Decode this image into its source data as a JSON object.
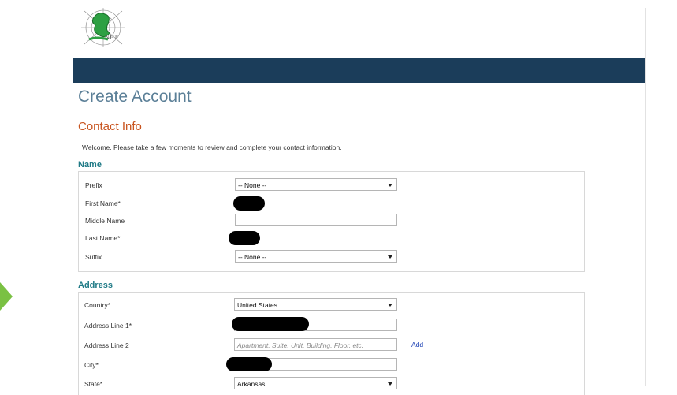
{
  "colors": {
    "banner": "#1b3d5a",
    "title": "#5b7f97",
    "section": "#c8541f",
    "group": "#1f7a86",
    "link": "#1a3fb3",
    "arrow": "#7ac143"
  },
  "logo": {
    "text": "NET",
    "icon": "weird-net-logo-icon"
  },
  "page": {
    "title": "Create Account",
    "section": "Contact Info",
    "welcome": "Welcome. Please take a few moments to review and complete your contact information."
  },
  "name_group": {
    "label": "Name",
    "prefix": {
      "label": "Prefix",
      "value": "-- None --"
    },
    "first_name": {
      "label": "First Name*"
    },
    "middle_name": {
      "label": "Middle Name",
      "value": ""
    },
    "last_name": {
      "label": "Last Name*"
    },
    "suffix": {
      "label": "Suffix",
      "value": "-- None --"
    }
  },
  "address_group": {
    "label": "Address",
    "country": {
      "label": "Country*",
      "value": "United States"
    },
    "line1": {
      "label": "Address Line 1*"
    },
    "line2": {
      "label": "Address Line 2",
      "placeholder": "Apartment, Suite, Unit, Building, Floor, etc.",
      "add_label": "Add"
    },
    "city": {
      "label": "City*"
    },
    "state": {
      "label": "State*",
      "value": "Arkansas"
    }
  }
}
